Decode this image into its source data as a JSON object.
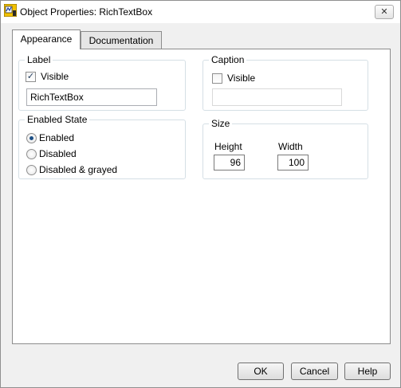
{
  "window": {
    "title": "Object Properties: RichTextBox",
    "close_glyph": "✕"
  },
  "tabs": [
    {
      "label": "Appearance",
      "active": true
    },
    {
      "label": "Documentation",
      "active": false
    }
  ],
  "label_group": {
    "title": "Label",
    "visible_label": "Visible",
    "visible_checked": true,
    "value": "RichTextBox"
  },
  "caption_group": {
    "title": "Caption",
    "visible_label": "Visible",
    "visible_checked": false,
    "value": ""
  },
  "enabled_state": {
    "title": "Enabled State",
    "options": [
      "Enabled",
      "Disabled",
      "Disabled & grayed"
    ],
    "selected": "Enabled"
  },
  "size_group": {
    "title": "Size",
    "height_label": "Height",
    "height_value": "96",
    "width_label": "Width",
    "width_value": "100"
  },
  "buttons": {
    "ok": "OK",
    "cancel": "Cancel",
    "help": "Help"
  },
  "icons": {
    "app": "labview-app-icon",
    "check": "✓"
  }
}
